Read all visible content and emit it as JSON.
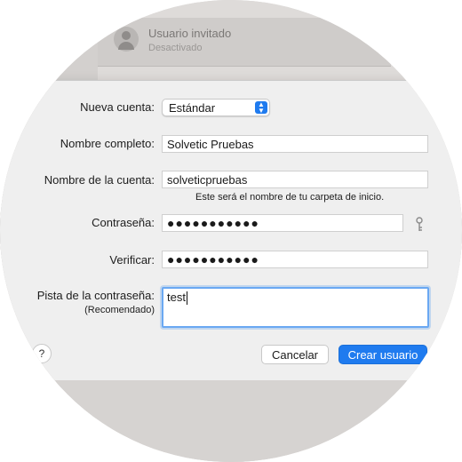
{
  "background": {
    "guest_user": {
      "name": "Usuario invitado",
      "status": "Desactivado"
    }
  },
  "form": {
    "account_type": {
      "label": "Nueva cuenta:",
      "value": "Estándar"
    },
    "full_name": {
      "label": "Nombre completo:",
      "value": "Solvetic Pruebas"
    },
    "account_name": {
      "label": "Nombre de la cuenta:",
      "value": "solveticpruebas",
      "hint": "Este será el nombre de tu carpeta de inicio."
    },
    "password": {
      "label": "Contraseña:",
      "value": "●●●●●●●●●●●"
    },
    "verify": {
      "label": "Verificar:",
      "value": "●●●●●●●●●●●"
    },
    "password_hint": {
      "label": "Pista de la contraseña:",
      "sublabel": "(Recomendado)",
      "value": "test"
    }
  },
  "buttons": {
    "help": "?",
    "cancel": "Cancelar",
    "create": "Crear usuario"
  },
  "colors": {
    "accent": "#1f7bef",
    "focus_ring": "#6aa8f2"
  }
}
